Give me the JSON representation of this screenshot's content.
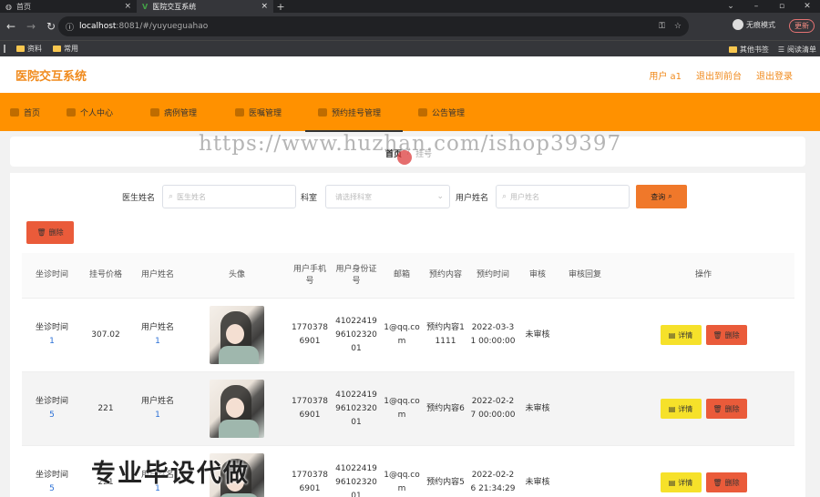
{
  "browser": {
    "tabs": [
      {
        "title": "首页",
        "active": false
      },
      {
        "title": "医院交互系统",
        "active": true
      }
    ],
    "url_host": "localhost",
    "url_rest": ":8081/#/yuyueguahao",
    "profile_label": "无痕模式",
    "update_label": "更新",
    "bookmarks": [
      "资料",
      "常用"
    ],
    "bookmarks_right": [
      "其他书签",
      "阅读清单"
    ]
  },
  "header": {
    "title": "医院交互系统",
    "user": "用户 a1",
    "back_front": "退出到前台",
    "logout": "退出登录"
  },
  "menu": [
    {
      "label": "首页"
    },
    {
      "label": "个人中心"
    },
    {
      "label": "病例管理"
    },
    {
      "label": "医嘱管理"
    },
    {
      "label": "预约挂号管理"
    },
    {
      "label": "公告管理"
    }
  ],
  "breadcrumb": {
    "home": "首页",
    "sep": "/",
    "current": "挂号"
  },
  "watermark": "https://www.huzhan.com/ishop39397",
  "search": {
    "doctor_label": "医生姓名",
    "doctor_placeholder": "医生姓名",
    "dept_label": "科室",
    "dept_placeholder": "请选择科室",
    "user_label": "用户姓名",
    "user_placeholder": "用户姓名",
    "query_label": "查询"
  },
  "delete_label": "删除",
  "table": {
    "headers": [
      "坐诊时间",
      "挂号价格",
      "用户姓名",
      "头像",
      "用户手机号",
      "用户身份证号",
      "邮箱",
      "预约内容",
      "预约时间",
      "审核",
      "审核回复",
      "操作"
    ],
    "rows": [
      {
        "zztime_a": "坐诊时间",
        "zztime_b": "1",
        "price": "307.02",
        "name_a": "用户姓名",
        "name_b": "1",
        "phone": "17703786901",
        "idcard": "410224199610232001",
        "email": "1@qq.com",
        "content": "预约内容11111",
        "time": "2022-03-31 00:00:00",
        "audit": "未审核",
        "reply": ""
      },
      {
        "zztime_a": "坐诊时间",
        "zztime_b": "5",
        "price": "221",
        "name_a": "用户姓名",
        "name_b": "1",
        "phone": "17703786901",
        "idcard": "410224199610232001",
        "email": "1@qq.com",
        "content": "预约内容6",
        "time": "2022-02-27 00:00:00",
        "audit": "未审核",
        "reply": ""
      },
      {
        "zztime_a": "坐诊时间",
        "zztime_b": "5",
        "price": "221",
        "name_a": "用户姓名",
        "name_b": "1",
        "phone": "17703786901",
        "idcard": "410224199610232001",
        "email": "1@qq.com",
        "content": "预约内容5",
        "time": "2022-02-26 21:34:29",
        "audit": "未审核",
        "reply": ""
      }
    ],
    "detail_label": "详情",
    "delete_label": "删除"
  },
  "bottom_watermark": "专业毕设代做"
}
